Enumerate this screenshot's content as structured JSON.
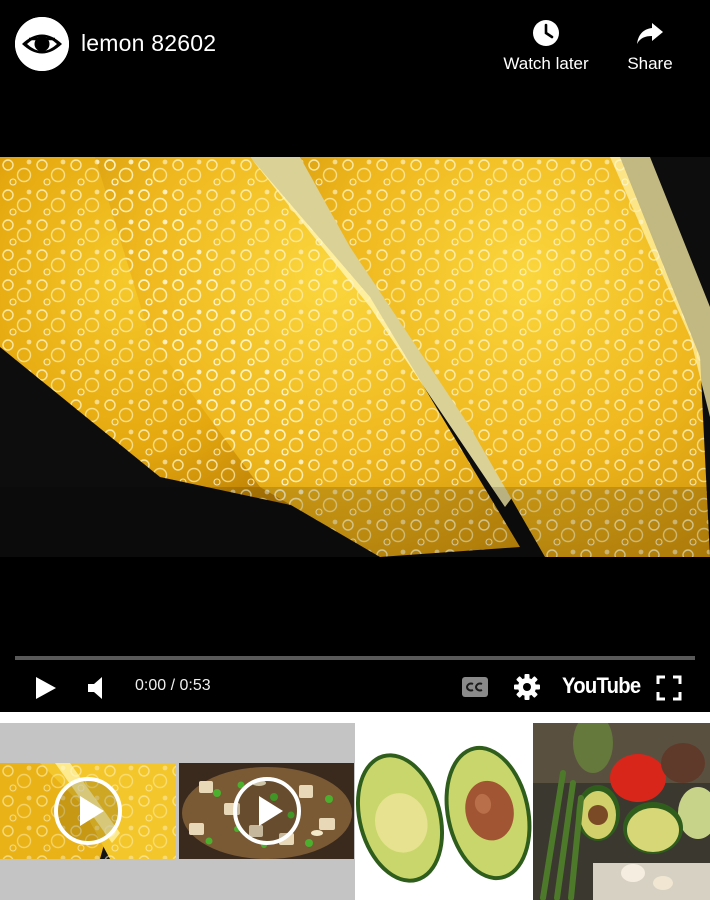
{
  "video": {
    "title": "lemon 82602",
    "time_current": "0:00",
    "time_separator": " / ",
    "time_total": "0:53",
    "progress": 0.0
  },
  "top_actions": {
    "watch_later_label": "Watch later",
    "share_label": "Share"
  },
  "controls": {
    "youtube_logo": "YouTube",
    "icons": [
      "play-icon",
      "volume-icon",
      "cc-icon",
      "gear-icon",
      "fullscreen-icon"
    ]
  },
  "colors": {
    "player_bg": "#000000",
    "progress_played": "#ff0000",
    "playlist_bg": "#c4c4c4"
  },
  "related": [
    {
      "thumbnail": "lemon slices in sparkling water",
      "has_play_icon": true
    },
    {
      "thumbnail": "tofu and green onion dish",
      "has_play_icon": true
    },
    {
      "thumbnail": "halved avocado",
      "has_play_icon": false
    },
    {
      "thumbnail": "asparagus, avocado and tomatoes",
      "has_play_icon": false
    }
  ]
}
